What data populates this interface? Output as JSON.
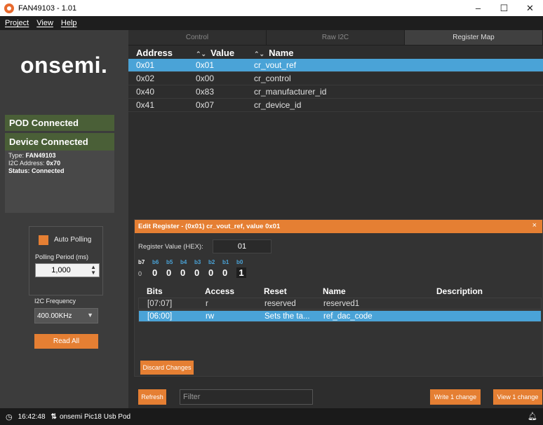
{
  "window": {
    "title": "FAN49103 - 1.01",
    "minimize": "–",
    "maximize": "☐",
    "close": "✕"
  },
  "menu": [
    "Project",
    "View",
    "Help"
  ],
  "sidebar": {
    "logo": "onsemi.",
    "pod_status": "POD Connected",
    "device_status": "Device Connected",
    "device_type_label": "Type:",
    "device_type": "FAN49103",
    "i2c_address_label": "I2C Address:",
    "i2c_address": "0x70",
    "status_label": "Status:",
    "status": "Connected",
    "auto_polling": "Auto Polling",
    "polling_period_label": "Polling Period (ms)",
    "polling_period": "1,000",
    "i2c_frequency_label": "I2C Frequency",
    "i2c_frequency": "400.00KHz",
    "read_all": "Read All"
  },
  "tabs": [
    "Control",
    "Raw I2C",
    "Register Map"
  ],
  "register_table": {
    "headers": [
      "Address",
      "Value",
      "Name"
    ],
    "rows": [
      {
        "address": "0x01",
        "value": "0x01",
        "name": "cr_vout_ref"
      },
      {
        "address": "0x02",
        "value": "0x00",
        "name": "cr_control"
      },
      {
        "address": "0x40",
        "value": "0x83",
        "name": "cr_manufacturer_id"
      },
      {
        "address": "0x41",
        "value": "0x07",
        "name": "cr_device_id"
      }
    ]
  },
  "edit_register": {
    "title": "Edit Register - (0x01) cr_vout_ref, value 0x01",
    "close": "×",
    "hex_label": "Register Value (HEX):",
    "hex_value": "01",
    "bit_labels": [
      "b7",
      "b6",
      "b5",
      "b4",
      "b3",
      "b2",
      "b1",
      "b0"
    ],
    "bit_values": [
      "0",
      "0",
      "0",
      "0",
      "0",
      "0",
      "0",
      "1"
    ],
    "bits_headers": [
      "Bits",
      "Access",
      "Reset",
      "Name",
      "Description"
    ],
    "bits_rows": [
      {
        "bits": "[07:07]",
        "access": "r",
        "reset": "reserved",
        "name": "reserved1",
        "description": ""
      },
      {
        "bits": "[06:00]",
        "access": "rw",
        "reset": "Sets the ta...",
        "name": "ref_dac_code",
        "description": ""
      }
    ],
    "discard": "Discard Changes"
  },
  "toolbar": {
    "refresh": "Refresh",
    "filter_placeholder": "Filter",
    "write": "Write 1 change",
    "view": "View 1 change"
  },
  "statusbar": {
    "time": "16:42:48",
    "pod": "onsemi Pic18 Usb Pod"
  },
  "colors": {
    "accent": "#e57f33",
    "selection": "#4aa3d7",
    "connected": "#4a5f37"
  }
}
